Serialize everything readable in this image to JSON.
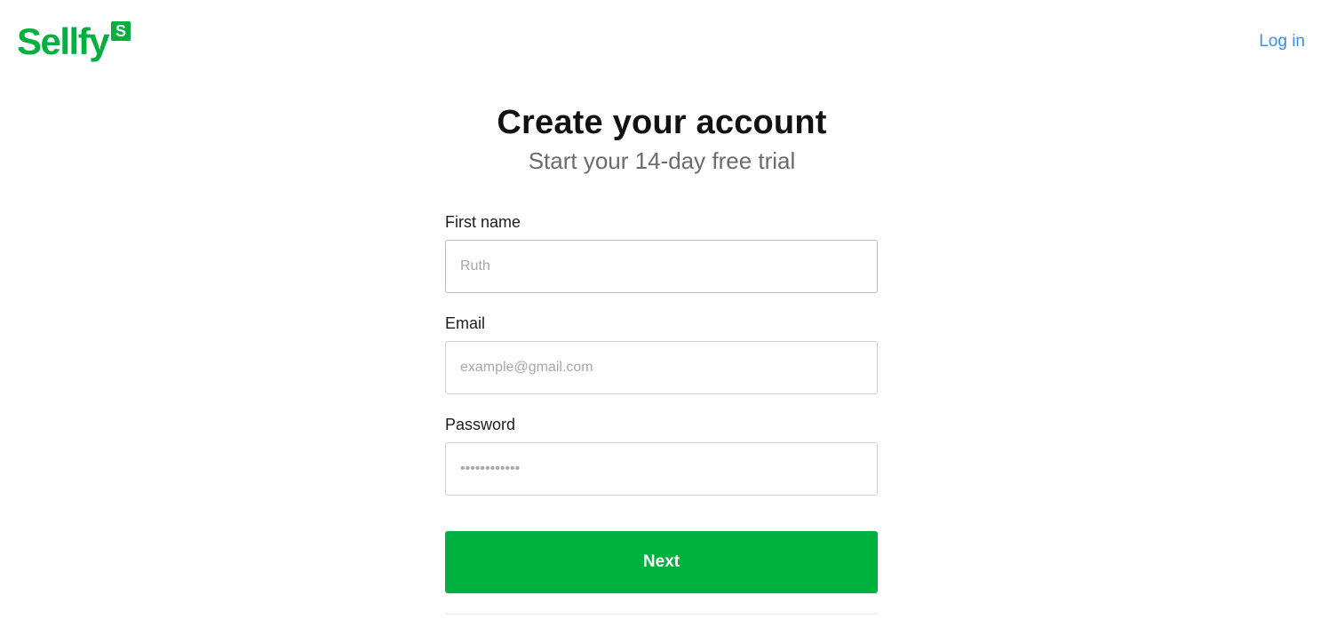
{
  "header": {
    "logo_text": "Sellfy",
    "logo_badge": "S",
    "login_label": "Log in"
  },
  "main": {
    "title": "Create your account",
    "subtitle": "Start your 14-day free trial"
  },
  "form": {
    "first_name": {
      "label": "First name",
      "placeholder": "Ruth",
      "value": ""
    },
    "email": {
      "label": "Email",
      "placeholder": "example@gmail.com",
      "value": ""
    },
    "password": {
      "label": "Password",
      "placeholder": "••••••••••••",
      "value": ""
    },
    "submit_label": "Next"
  },
  "colors": {
    "brand": "#00b140",
    "link": "#3a8fe6"
  }
}
